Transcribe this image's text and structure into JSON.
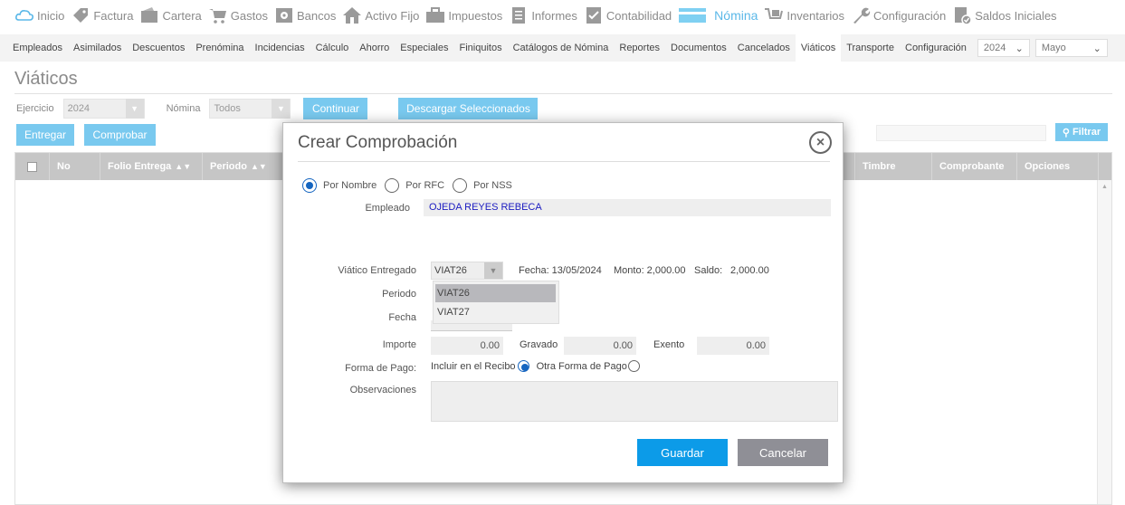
{
  "topnav": [
    {
      "label": "Inicio",
      "icon": "cloud-icon",
      "active": false
    },
    {
      "label": "Factura",
      "icon": "tag-icon",
      "active": false
    },
    {
      "label": "Cartera",
      "icon": "wallet-icon",
      "active": false
    },
    {
      "label": "Gastos",
      "icon": "cart-icon",
      "active": false
    },
    {
      "label": "Bancos",
      "icon": "safe-icon",
      "active": false
    },
    {
      "label": "Activo Fijo",
      "icon": "house-icon",
      "active": false
    },
    {
      "label": "Impuestos",
      "icon": "briefcase-icon",
      "active": false
    },
    {
      "label": "Informes",
      "icon": "document-icon",
      "active": false
    },
    {
      "label": "Contabilidad",
      "icon": "checklist-icon",
      "active": false
    },
    {
      "label": "Nómina",
      "icon": "card-icon",
      "active": true
    },
    {
      "label": "Inventarios",
      "icon": "cart-box-icon",
      "active": false
    },
    {
      "label": "Configuración",
      "icon": "wrench-icon",
      "active": false
    },
    {
      "label": "Saldos Iniciales",
      "icon": "clipboard-check-icon",
      "active": false
    }
  ],
  "subnav": {
    "items": [
      "Empleados",
      "Asimilados",
      "Descuentos",
      "Prenómina",
      "Incidencias",
      "Cálculo",
      "Ahorro",
      "Especiales",
      "Finiquitos",
      "Catálogos de Nómina",
      "Reportes",
      "Documentos",
      "Cancelados",
      "Viáticos",
      "Transporte",
      "Configuración"
    ],
    "active_index": 13,
    "year": "2024",
    "month": "Mayo"
  },
  "page": {
    "title": "Viáticos",
    "ejercicio_label": "Ejercicio",
    "ejercicio_value": "2024",
    "nomina_label": "Nómina",
    "nomina_value": "Todos",
    "continuar": "Continuar",
    "descargar": "Descargar Seleccionados",
    "entregar": "Entregar",
    "comprobar": "Comprobar",
    "filtrar": "Filtrar"
  },
  "grid": {
    "columns": [
      "No",
      "Folio Entrega",
      "Periodo",
      "Timbre",
      "Comprobante",
      "Opciones"
    ]
  },
  "modal": {
    "title": "Crear Comprobación",
    "radio_nombre": "Por Nombre",
    "radio_rfc": "Por RFC",
    "radio_nss": "Por NSS",
    "empleado_label": "Empleado",
    "empleado_value": "OJEDA REYES REBECA",
    "viatico_label": "Viático Entregado",
    "viatico_value": "VIAT26",
    "viatico_options": [
      "VIAT26",
      "VIAT27"
    ],
    "fecha_info": "Fecha: 13/05/2024",
    "monto_info": "Monto: 2,000.00",
    "saldo_label": "Saldo:",
    "saldo_value": "2,000.00",
    "periodo_label": "Periodo",
    "fecha_label": "Fecha",
    "importe_label": "Importe",
    "importe_value": "0.00",
    "gravado_label": "Gravado",
    "gravado_value": "0.00",
    "exento_label": "Exento",
    "exento_value": "0.00",
    "forma_pago_label": "Forma de Pago:",
    "incluir_label": "Incluir en el Recibo",
    "otra_label": "Otra Forma de Pago",
    "observaciones_label": "Observaciones",
    "guardar": "Guardar",
    "cancelar": "Cancelar"
  }
}
